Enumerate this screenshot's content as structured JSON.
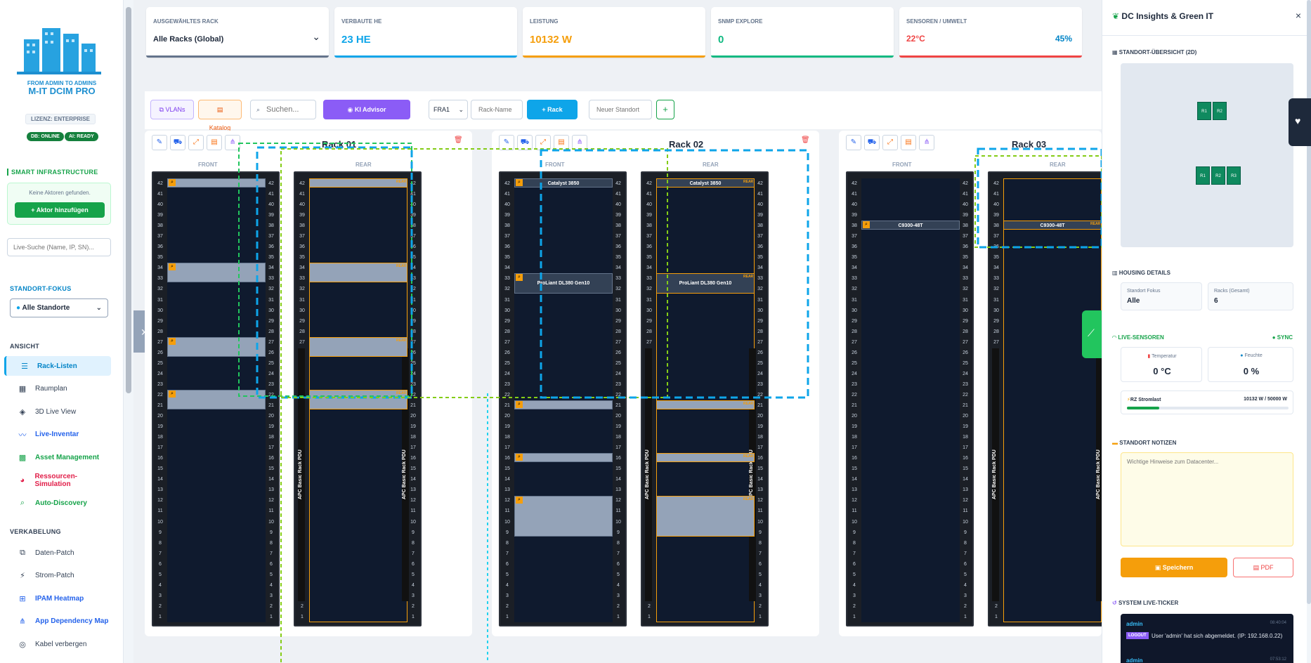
{
  "brand": {
    "tagline": "FROM ADMIN TO ADMINS",
    "name": "M-IT DCIM PRO",
    "license": "LIZENZ: ENTERPRISE",
    "db": "DB: ONLINE",
    "ai": "AI: READY"
  },
  "sidebar": {
    "smart_title": "SMART INFRASTRUCTURE",
    "no_actors": "Keine Aktoren gefunden.",
    "add_actor": "+ Aktor hinzufügen",
    "search_placeholder": "Live-Suche (Name, IP, SN)...",
    "location_title": "STANDORT-FOKUS",
    "location_value": "Alle Standorte",
    "view_title": "ANSICHT",
    "view_items": [
      {
        "label": "Rack-Listen",
        "icon": "list-icon",
        "color": "#0284c7"
      },
      {
        "label": "Raumplan",
        "icon": "map-icon",
        "color": "#334155"
      },
      {
        "label": "3D Live View",
        "icon": "cube-icon",
        "color": "#334155"
      },
      {
        "label": "Live-Inventar",
        "icon": "pulse-icon",
        "color": "#2563eb"
      },
      {
        "label": "Asset Management",
        "icon": "boxes-icon",
        "color": "#16a34a"
      },
      {
        "label": "Ressourcen-Simulation",
        "icon": "pie-icon",
        "color": "#e11d48"
      },
      {
        "label": "Auto-Discovery",
        "icon": "search-icon",
        "color": "#16a34a"
      }
    ],
    "cable_title": "VERKABELUNG",
    "cable_items": [
      {
        "label": "Daten-Patch",
        "icon": "network-icon",
        "color": "#334155"
      },
      {
        "label": "Strom-Patch",
        "icon": "bolt-icon",
        "color": "#334155"
      },
      {
        "label": "IPAM Heatmap",
        "icon": "sitemap-icon",
        "color": "#2563eb"
      },
      {
        "label": "App Dependency Map",
        "icon": "project-icon",
        "color": "#2563eb"
      },
      {
        "label": "Kabel verbergen",
        "icon": "eye-slash-icon",
        "color": "#334155"
      }
    ]
  },
  "stats": [
    {
      "label": "AUSGEWÄHLTES RACK",
      "value": "Alle Racks (Global)",
      "color": "#1e293b",
      "bar": "#64748b"
    },
    {
      "label": "VERBAUTE HE",
      "value": "23 HE",
      "color": "#0ea5e9",
      "bar": "#0ea5e9"
    },
    {
      "label": "LEISTUNG",
      "value": "10132 W",
      "color": "#f59e0b",
      "bar": "#f59e0b"
    },
    {
      "label": "SNMP EXPLORE",
      "value": "0",
      "color": "#10b981",
      "bar": "#10b981"
    },
    {
      "label": "SENSOREN / UMWELT",
      "value": "22°C",
      "value2": "45%",
      "color": "#ef4444",
      "color2": "#0284c7",
      "bar": "#ef4444"
    }
  ],
  "toolbar": {
    "vlans": "VLANs",
    "catalog": "Katalog",
    "search_placeholder": "Suchen...",
    "ai": "KI Advisor",
    "site": "FRA1",
    "rack_placeholder": "Rack-Name",
    "add_rack": "+ Rack",
    "new_site_placeholder": "Neuer Standort",
    "plus": "+"
  },
  "racks": [
    {
      "title": "Rack 01",
      "front": "FRONT",
      "rear": "REAR",
      "pdu": "APC Basic Rack PDU"
    },
    {
      "title": "Rack 02",
      "front": "FRONT",
      "rear": "REAR",
      "pdu": "APC Basic Rack PDU"
    },
    {
      "title": "Rack 03",
      "front": "FRONT",
      "rear": "REAR",
      "pdu": "APC Basic Rack PDU"
    }
  ],
  "devices": {
    "catalyst": "Catalyst 3850",
    "proliant": "ProLiant DL380 Gen10",
    "c9300": "C9300-48T",
    "rear_tag": "REAR"
  },
  "panel": {
    "title": "DC Insights & Green IT",
    "close": "×",
    "overview": "STANDORT-ÜBERSICHT (2D)",
    "rk1": "R1",
    "rk2": "R2",
    "rk3": "R3",
    "housing": "HOUSING DETAILS",
    "focus_label": "Standort Fokus",
    "focus_value": "Alle",
    "racks_label": "Racks (Gesamt)",
    "racks_value": "6",
    "sensors": "LIVE-SENSOREN",
    "sync": "● SYNC",
    "temp_label": "Temperatur",
    "temp_value": "0 °C",
    "hum_label": "Feuchte",
    "hum_value": "0 %",
    "power_label": "RZ Stromlast",
    "power_value": "10132 W / 50000 W",
    "power_fraction": 0.2,
    "notes": "STANDORT NOTIZEN",
    "notes_placeholder": "Wichtige Hinweise zum Datacenter...",
    "save": "Speichern",
    "pdf": "PDF",
    "ticker": "SYSTEM LIVE-TICKER",
    "t_user": "admin",
    "t_time": "08:40:04",
    "t_tag": "LOGOUT",
    "t_msg": "User 'admin' hat sich abgemeldet. (IP: 192.168.0.22)",
    "t_user2": "admin",
    "t_time2": "07:53:12"
  }
}
